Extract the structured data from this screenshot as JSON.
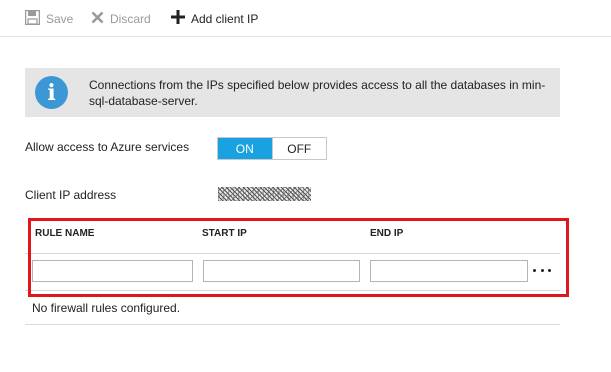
{
  "toolbar": {
    "save_label": "Save",
    "discard_label": "Discard",
    "add_client_ip_label": "Add client IP"
  },
  "banner": {
    "icon": "info-icon",
    "text": "Connections from the IPs specified below provides access to all the databases in min-sql-database-server."
  },
  "azure_access": {
    "label": "Allow access to Azure services",
    "on_label": "ON",
    "off_label": "OFF",
    "selected": "ON"
  },
  "client_ip": {
    "label": "Client IP address"
  },
  "rules_table": {
    "columns": [
      "RULE NAME",
      "START IP",
      "END IP"
    ],
    "new_row": {
      "rule_name": "",
      "start_ip": "",
      "end_ip": ""
    },
    "more_label": "...",
    "empty_message": "No firewall rules configured."
  },
  "colors": {
    "toggle_on": "#1aa1e1",
    "highlight": "#e0161c",
    "info": "#3b98d4"
  }
}
